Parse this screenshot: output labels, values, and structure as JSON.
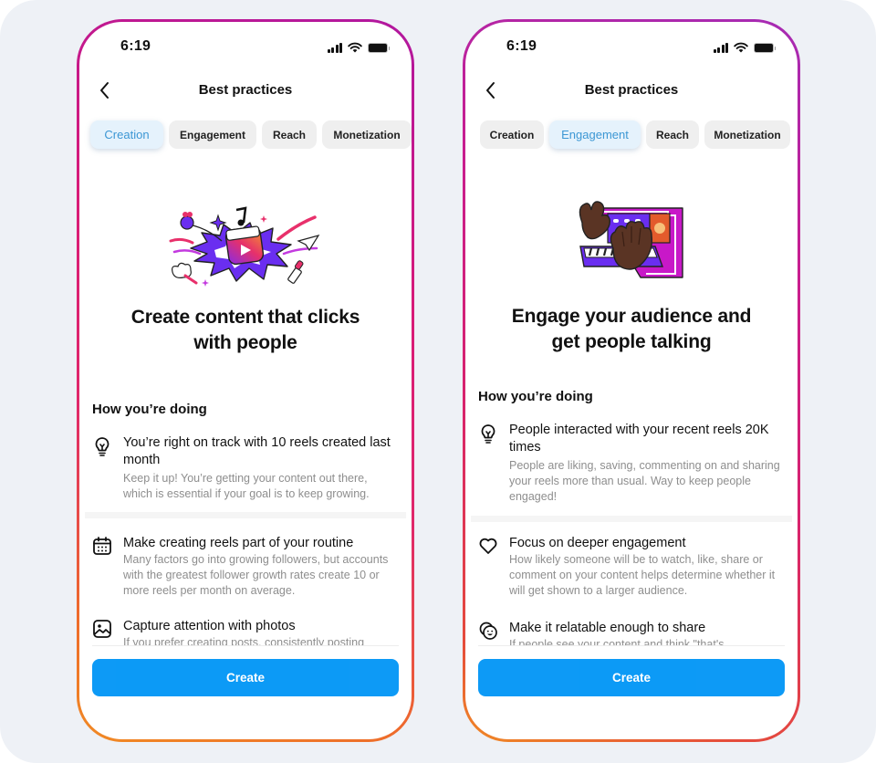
{
  "phones": [
    {
      "status": {
        "time": "6:19"
      },
      "nav": {
        "title": "Best practices"
      },
      "tabs": [
        {
          "label": "Creation",
          "active": true
        },
        {
          "label": "Engagement",
          "active": false
        },
        {
          "label": "Reach",
          "active": false
        },
        {
          "label": "Monetization",
          "active": false
        }
      ],
      "illustration": "reels-burst-illustration",
      "headline_line1": "Create content that clicks",
      "headline_line2": "with people",
      "section_heading": "How you’re doing",
      "status_item": {
        "icon": "lightbulb-icon",
        "title": "You’re right on track with 10 reels created last month",
        "desc": "Keep it up! You’re getting your content out there, which is essential if your goal is to keep growing."
      },
      "tips": [
        {
          "icon": "calendar-icon",
          "title": "Make creating reels part of your routine",
          "desc": "Many factors go into growing followers, but accounts with the greatest follower growth rates create 10 or more reels per month on average."
        },
        {
          "icon": "photo-icon",
          "title": "Capture attention with photos",
          "desc": "If you prefer creating posts, consistently posting"
        }
      ],
      "cta": "Create"
    },
    {
      "status": {
        "time": "6:19"
      },
      "nav": {
        "title": "Best practices"
      },
      "tabs": [
        {
          "label": "Creation",
          "active": false
        },
        {
          "label": "Engagement",
          "active": true
        },
        {
          "label": "Reach",
          "active": false
        },
        {
          "label": "Monetization",
          "active": false
        }
      ],
      "illustration": "hands-on-keyboard-illustration",
      "headline_line1": "Engage your audience and",
      "headline_line2": "get people talking",
      "section_heading": "How you’re doing",
      "status_item": {
        "icon": "lightbulb-icon",
        "title": "People interacted with your recent reels 20K times",
        "desc": "People are liking, saving, commenting on and sharing your reels more than usual. Way to keep people engaged!"
      },
      "tips": [
        {
          "icon": "heart-icon",
          "title": "Focus on deeper engagement",
          "desc": "How likely someone will be to watch, like, share or comment on your content helps determine whether it will get shown to a larger audience."
        },
        {
          "icon": "smiley-share-icon",
          "title": "Make it relatable enough to share",
          "desc": "If people see your content and think \"that's"
        }
      ],
      "cta": "Create"
    }
  ],
  "colors": {
    "accent": "#0095f6",
    "active_tab_text": "#3c97d4",
    "active_tab_bg": "#e5f2fc",
    "frame_gradient_top": "#b1179f",
    "frame_gradient_bottom": "#f08a24",
    "backdrop": "#eef1f6"
  }
}
